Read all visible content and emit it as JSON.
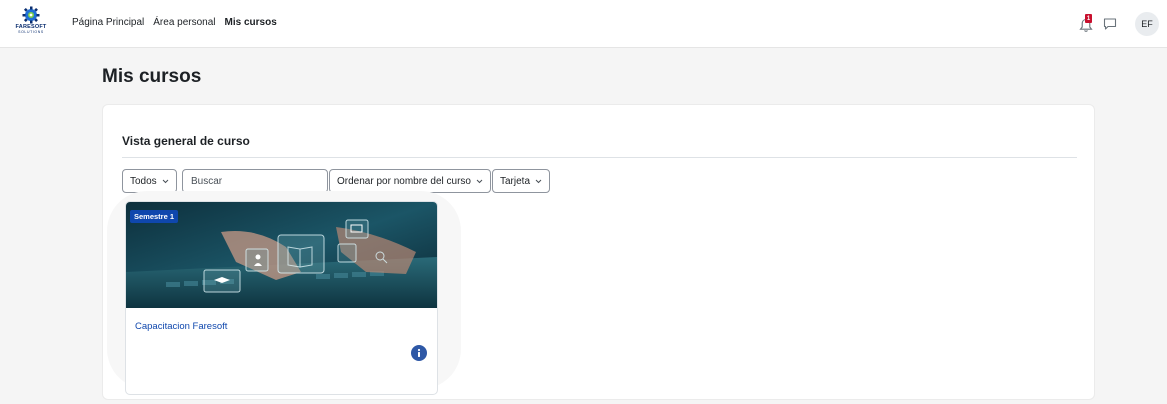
{
  "brand": {
    "name": "FARESOFT",
    "tagline": "SOLUTIONS"
  },
  "nav": {
    "links": [
      {
        "label": "Página Principal",
        "active": false
      },
      {
        "label": "Área personal",
        "active": false
      },
      {
        "label": "Mis cursos",
        "active": true
      }
    ],
    "notification_count": "1",
    "avatar_initials": "EF"
  },
  "page": {
    "title": "Mis cursos"
  },
  "overview": {
    "title": "Vista general de curso",
    "filters": {
      "grouping": "Todos",
      "search_placeholder": "Buscar",
      "sort": "Ordenar por nombre del curso",
      "view": "Tarjeta"
    },
    "courses": [
      {
        "name": "Capacitacion Faresoft",
        "category_badge": "Semestre 1"
      }
    ]
  },
  "colors": {
    "accent": "#0f47ad",
    "badge": "#c8102e",
    "info": "#2e58a6"
  }
}
